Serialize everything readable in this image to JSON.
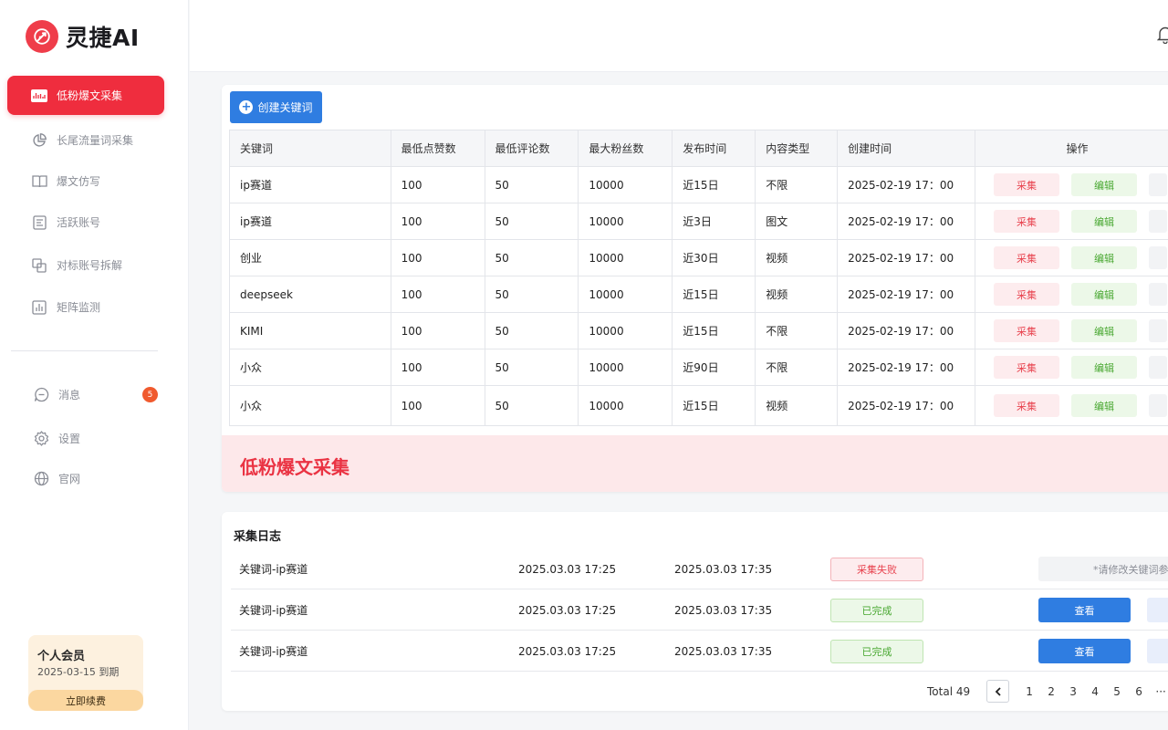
{
  "brand": {
    "name": "灵捷AI",
    "color": "#ef2d3e",
    "icon": "rocket-icon"
  },
  "sidebar": {
    "items": [
      {
        "label": "低粉爆文采集",
        "icon": "chart-badge-icon",
        "active": true
      },
      {
        "label": "长尾流量词采集",
        "icon": "pie-chart-icon",
        "active": false
      },
      {
        "label": "爆文仿写",
        "icon": "open-book-icon",
        "active": false
      },
      {
        "label": "活跃账号",
        "icon": "document-list-icon",
        "active": false
      },
      {
        "label": "对标账号拆解",
        "icon": "copy-icon",
        "active": false
      },
      {
        "label": "矩阵监测",
        "icon": "bar-chart-icon",
        "active": false
      }
    ],
    "bottom_items": [
      {
        "label": "消息",
        "icon": "chat-bubble-icon",
        "badge": "5"
      },
      {
        "label": "设置",
        "icon": "gear-icon"
      },
      {
        "label": "官网",
        "icon": "globe-icon"
      }
    ],
    "member": {
      "title": "个人会员",
      "expiry": "2025-03-15 到期",
      "renew_label": "立即续费"
    }
  },
  "keywords": {
    "create_label": "创建关键词",
    "columns": [
      "关键词",
      "最低点赞数",
      "最低评论数",
      "最大粉丝数",
      "发布时间",
      "内容类型",
      "创建时间",
      "操作"
    ],
    "collect_label": "采集",
    "edit_label": "编辑",
    "rows": [
      {
        "keyword": "ip赛道",
        "min_likes": "100",
        "min_comments": "50",
        "max_fans": "10000",
        "publish": "近15日",
        "type": "不限",
        "created": "2025-02-19 17：00"
      },
      {
        "keyword": "ip赛道",
        "min_likes": "100",
        "min_comments": "50",
        "max_fans": "10000",
        "publish": "近3日",
        "type": "图文",
        "created": "2025-02-19 17：00"
      },
      {
        "keyword": "创业",
        "min_likes": "100",
        "min_comments": "50",
        "max_fans": "10000",
        "publish": "近30日",
        "type": "视频",
        "created": "2025-02-19 17：00"
      },
      {
        "keyword": "deepseek",
        "min_likes": "100",
        "min_comments": "50",
        "max_fans": "10000",
        "publish": "近15日",
        "type": "视频",
        "created": "2025-02-19 17：00"
      },
      {
        "keyword": "KIMI",
        "min_likes": "100",
        "min_comments": "50",
        "max_fans": "10000",
        "publish": "近15日",
        "type": "不限",
        "created": "2025-02-19 17：00"
      },
      {
        "keyword": "小众",
        "min_likes": "100",
        "min_comments": "50",
        "max_fans": "10000",
        "publish": "近90日",
        "type": "不限",
        "created": "2025-02-19 17：00"
      },
      {
        "keyword": "小众",
        "min_likes": "100",
        "min_comments": "50",
        "max_fans": "10000",
        "publish": "近15日",
        "type": "视频",
        "created": "2025-02-19 17：00"
      }
    ],
    "banner": "低粉爆文采集"
  },
  "log": {
    "title": "采集日志",
    "rows": [
      {
        "name": "关键词-ip赛道",
        "start": "2025.03.03 17:25",
        "end": "2025.03.03 17:35",
        "status": "采集失败",
        "state": "fail",
        "hint": "*请修改关键词参数"
      },
      {
        "name": "关键词-ip赛道",
        "start": "2025.03.03 17:25",
        "end": "2025.03.03 17:35",
        "status": "已完成",
        "state": "done",
        "view_label": "查看"
      },
      {
        "name": "关键词-ip赛道",
        "start": "2025.03.03 17:25",
        "end": "2025.03.03 17:35",
        "status": "已完成",
        "state": "done",
        "view_label": "查看"
      }
    ],
    "pagination": {
      "total": "Total 49",
      "pages": [
        "1",
        "2",
        "3",
        "4",
        "5",
        "6"
      ],
      "ellipsis": "···"
    }
  },
  "topbar": {
    "icon": "bell-icon"
  }
}
